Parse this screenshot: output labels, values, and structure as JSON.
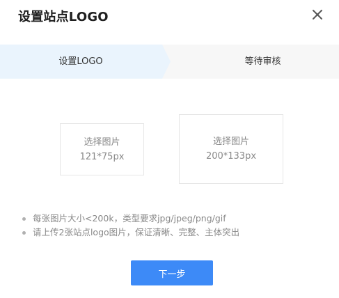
{
  "dialog": {
    "title": "设置站点LOGO",
    "close_icon": "close-icon"
  },
  "steps": [
    {
      "label": "设置LOGO",
      "active": true
    },
    {
      "label": "等待审核",
      "active": false
    }
  ],
  "uploads": [
    {
      "label": "选择图片",
      "size": "121*75px"
    },
    {
      "label": "选择图片",
      "size": "200*133px"
    }
  ],
  "tips": [
    "每张图片大小<200k，类型要求jpg/jpeg/png/gif",
    "请上传2张站点logo图片，保证清晰、完整、主体突出"
  ],
  "next_button": "下一步",
  "colors": {
    "primary": "#3d8af7",
    "step_active_bg": "#eaf4fd",
    "steps_bg": "#f7f7f7",
    "text_muted": "#888888"
  }
}
